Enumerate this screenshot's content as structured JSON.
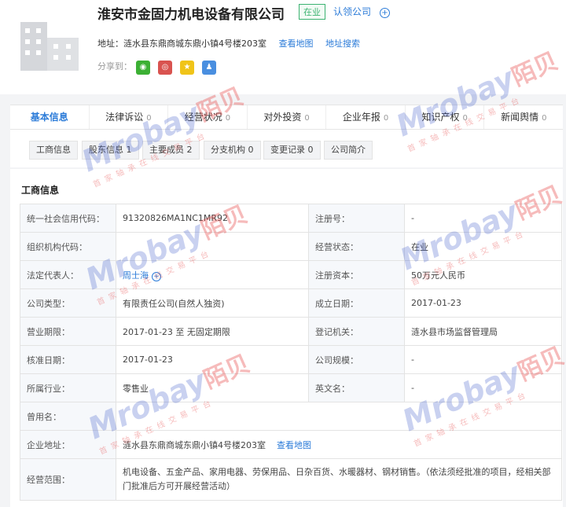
{
  "company": {
    "name": "淮安市金固力机电设备有限公司",
    "status": "在业",
    "claim_link": "认领公司",
    "follow_symbol": "+",
    "address_label": "地址：涟水县东鼎商城东鼎小镇4号楼203室",
    "view_map": "查看地图",
    "address_search": "地址搜索",
    "share_label": "分享到："
  },
  "tabs": [
    {
      "label": "基本信息",
      "count": ""
    },
    {
      "label": "法律诉讼",
      "count": "0"
    },
    {
      "label": "经营状况",
      "count": "0"
    },
    {
      "label": "对外投资",
      "count": "0"
    },
    {
      "label": "企业年报",
      "count": "0"
    },
    {
      "label": "知识产权",
      "count": "0"
    },
    {
      "label": "新闻舆情",
      "count": "0"
    }
  ],
  "subtabs": [
    "工商信息",
    "股东信息 1",
    "主要成员 2",
    "分支机构 0",
    "变更记录 0",
    "公司简介"
  ],
  "section_title": "工商信息",
  "info": {
    "credit_code_label": "统一社会信用代码：",
    "credit_code": "91320826MA1NC1MR92",
    "reg_no_label": "注册号：",
    "reg_no": "-",
    "org_code_label": "组织机构代码：",
    "org_code": "",
    "biz_status_label": "经营状态：",
    "biz_status": "在业",
    "legal_rep_label": "法定代表人：",
    "legal_rep": "周士海",
    "capital_label": "注册资本：",
    "capital": "50万元人民币",
    "type_label": "公司类型：",
    "type": "有限责任公司(自然人独资)",
    "est_date_label": "成立日期：",
    "est_date": "2017-01-23",
    "term_label": "营业期限：",
    "term": "2017-01-23 至 无固定期限",
    "authority_label": "登记机关：",
    "authority": "涟水县市场监督管理局",
    "approve_label": "核准日期：",
    "approve": "2017-01-23",
    "scale_label": "公司规模：",
    "scale": "-",
    "industry_label": "所属行业：",
    "industry": "零售业",
    "en_name_label": "英文名：",
    "en_name": "-",
    "former_name_label": "曾用名：",
    "former_name": "",
    "address_label": "企业地址：",
    "address": "涟水县东鼎商城东鼎小镇4号楼203室",
    "address_map": "查看地图",
    "scope_label": "经营范围：",
    "scope": "机电设备、五金产品、家用电器、劳保用品、日杂百货、水暖器材、钢材销售。（依法须经批准的项目，经相关部门批准后方可开展经营活动）"
  },
  "watermark": {
    "brand": "Mrobay",
    "cn": "陌贝",
    "slogan": "首家轴承在线交易平台"
  }
}
